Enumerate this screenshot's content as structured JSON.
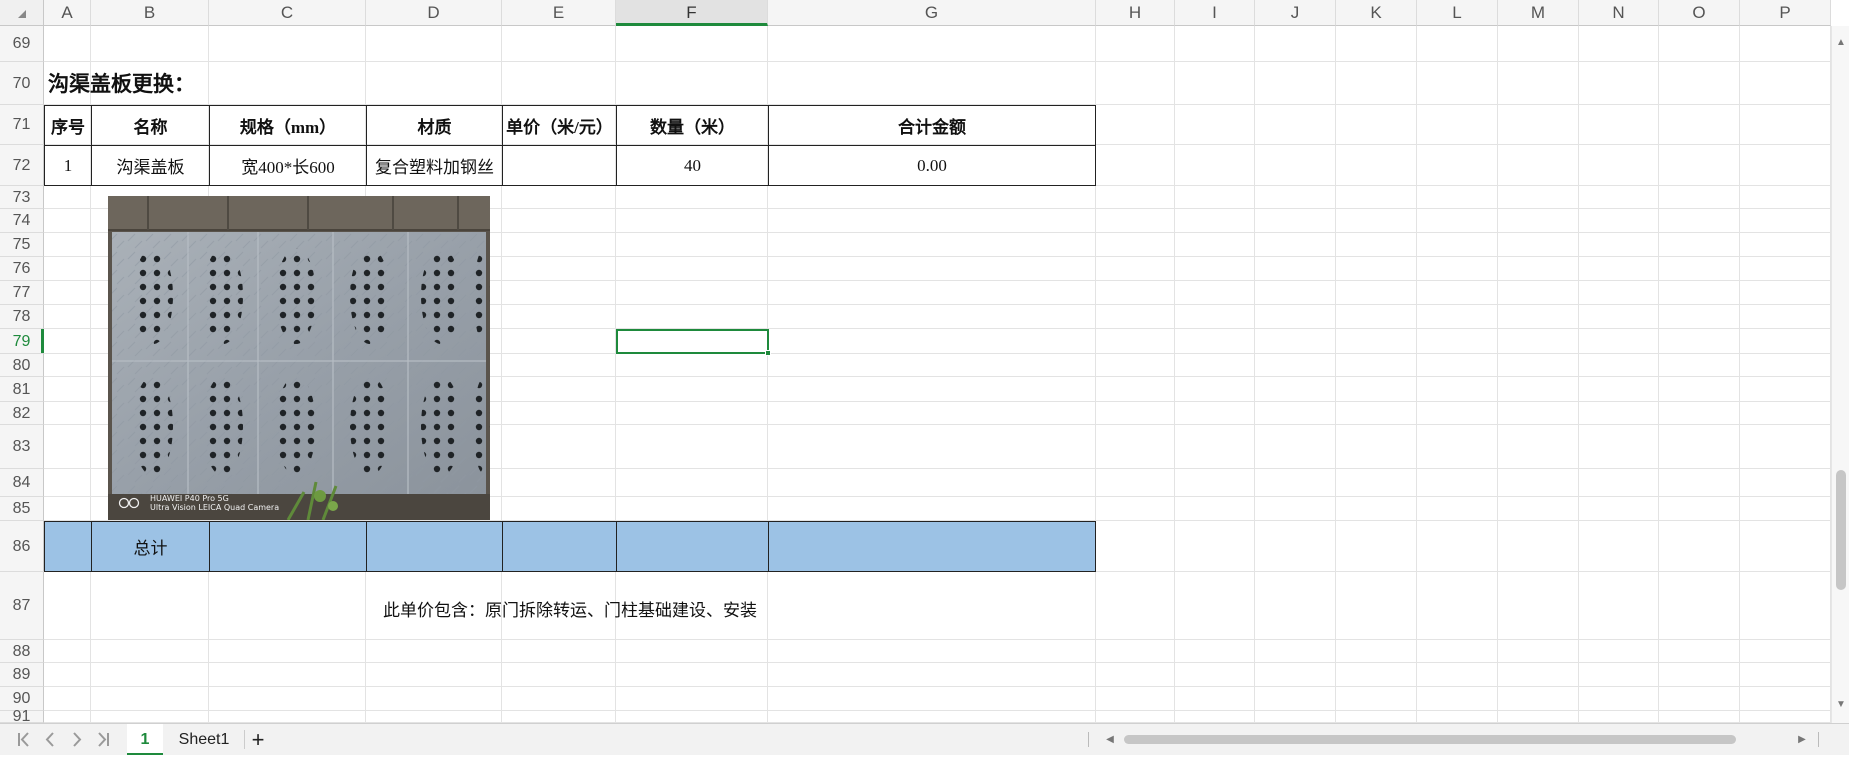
{
  "columns": [
    "A",
    "B",
    "C",
    "D",
    "E",
    "F",
    "G",
    "H",
    "I",
    "J",
    "K",
    "L",
    "M",
    "N",
    "O",
    "P"
  ],
  "selected_column": "F",
  "rows": [
    "69",
    "70",
    "71",
    "72",
    "73",
    "74",
    "75",
    "76",
    "77",
    "78",
    "79",
    "80",
    "81",
    "82",
    "83",
    "84",
    "85",
    "86",
    "87",
    "88",
    "89",
    "90",
    "91"
  ],
  "selected_row": "79",
  "section_title": "沟渠盖板更换：",
  "table_headers": [
    "序号",
    "名称",
    "规格（mm）",
    "材质",
    "单价（米/元）",
    "数量（米）",
    "合计金额"
  ],
  "table_row": [
    "1",
    "沟渠盖板",
    "宽400*长600",
    "复合塑料加钢丝",
    "",
    "40",
    "0.00"
  ],
  "total_label": "总计",
  "note": "此单价包含：原门拆除转运、门柱基础建设、安装",
  "photo_watermark_line1": "HUAWEI P40 Pro 5G",
  "photo_watermark_line2": "Ultra Vision LEICA Quad Camera",
  "sheet_tabs": [
    "1",
    "Sheet1"
  ],
  "add_sheet_label": "+",
  "colors": {
    "total_row_fill": "#9cc2e5",
    "selection_green": "#1e8a3c"
  },
  "icons": {
    "nav": [
      "first-sheet-icon",
      "prev-sheet-icon",
      "next-sheet-icon",
      "last-sheet-icon"
    ]
  }
}
